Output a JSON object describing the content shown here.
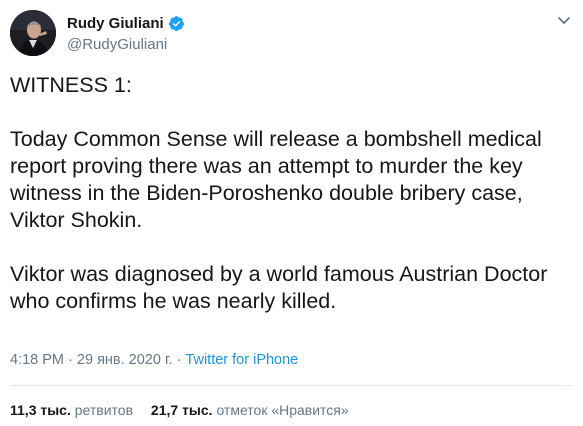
{
  "header": {
    "display_name": "Rudy Giuliani",
    "handle": "@RudyGiuliani",
    "verified_icon": "verified-badge-icon",
    "more_icon": "chevron-down-icon"
  },
  "tweet": {
    "paragraphs": [
      "WITNESS 1:",
      "Today Common Sense will release a bombshell medical report proving there was an attempt to murder the key witness in the Biden-Poroshenko double bribery case, Viktor Shokin.",
      "Viktor was diagnosed by a world famous Austrian Doctor who confirms he was nearly killed."
    ]
  },
  "meta": {
    "time": "4:18 PM",
    "separator": "·",
    "date": "29 янв. 2020 г.",
    "source": "Twitter for iPhone"
  },
  "stats": {
    "retweets_count": "11,3 тыс.",
    "retweets_label": "ретвитов",
    "likes_count": "21,7 тыс.",
    "likes_label": "отметок «Нравится»"
  },
  "colors": {
    "text": "#14171a",
    "muted": "#657786",
    "link": "#1b95e0",
    "verified": "#1da1f2",
    "divider": "#e1e8ed"
  }
}
